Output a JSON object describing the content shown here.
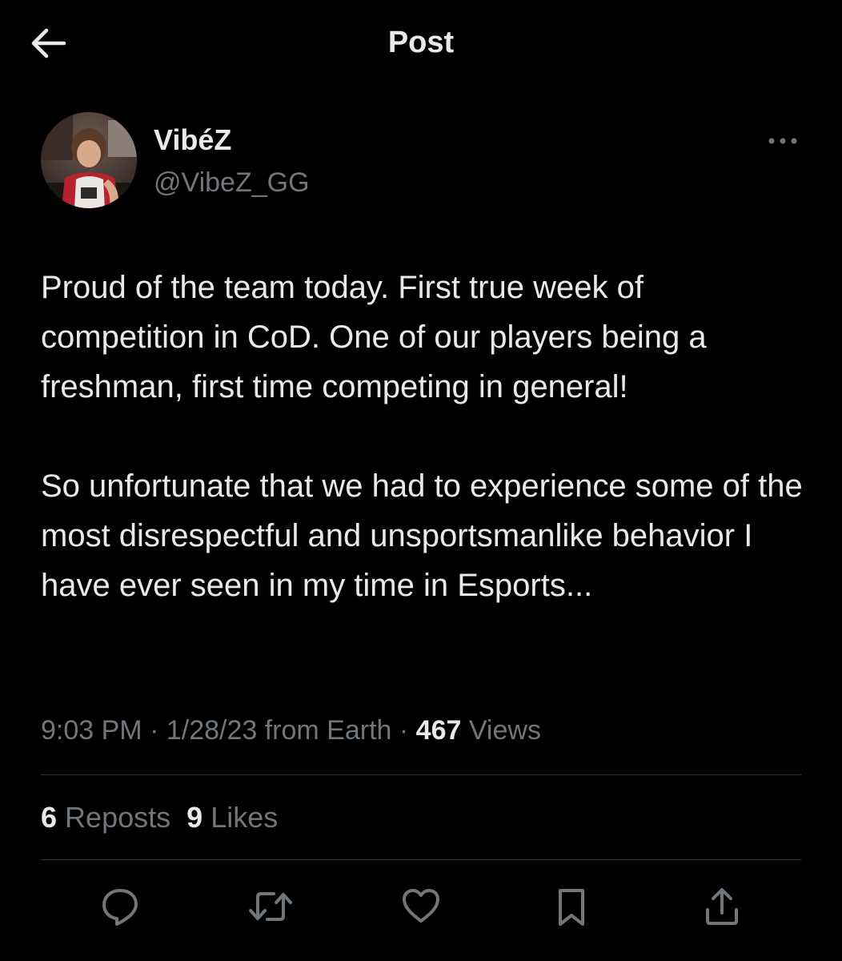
{
  "header": {
    "title": "Post",
    "back_icon": "arrow-left-icon"
  },
  "author": {
    "display_name": "VibéZ",
    "handle": "@VibeZ_GG",
    "more_icon": "ellipsis-icon"
  },
  "post": {
    "paragraphs": [
      "Proud of the team today. First true week of competition in CoD. One of our players being a freshman, first time competing in general!",
      "So unfortunate that we had to experience some of the most disrespectful and unsportsmanlike behavior I have ever seen in my time in Esports..."
    ]
  },
  "meta": {
    "time": "9:03 PM",
    "separator": " · ",
    "date_source": "1/28/23 from Earth",
    "views_count": "467",
    "views_label": "Views"
  },
  "stats": {
    "reposts_count": "6",
    "reposts_label": "Reposts",
    "likes_count": "9",
    "likes_label": "Likes"
  },
  "actions": {
    "reply_icon": "reply-icon",
    "repost_icon": "repost-icon",
    "like_icon": "heart-icon",
    "bookmark_icon": "bookmark-icon",
    "share_icon": "share-icon"
  },
  "colors": {
    "background": "#000000",
    "text_primary": "#e7e9ea",
    "text_secondary": "#71767b",
    "divider": "#2f3336"
  }
}
